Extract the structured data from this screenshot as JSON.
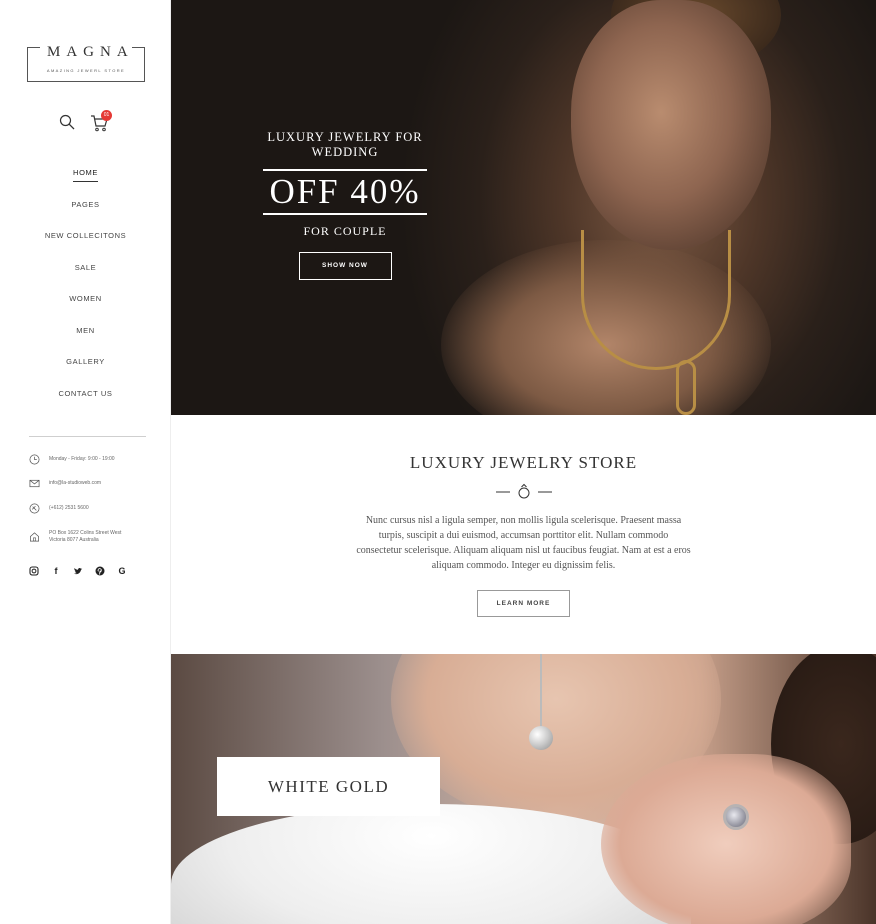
{
  "brand": {
    "name": "MAGNA",
    "tagline": "AMAZING JEWERL STORE"
  },
  "cart": {
    "count": "01"
  },
  "nav": {
    "items": [
      {
        "label": "HOME",
        "active": true
      },
      {
        "label": "PAGES"
      },
      {
        "label": "NEW COLLECITONS"
      },
      {
        "label": "SALE"
      },
      {
        "label": "WOMEN"
      },
      {
        "label": "MEN"
      },
      {
        "label": "GALLERY"
      },
      {
        "label": "CONTACT US"
      }
    ]
  },
  "contact": {
    "hours": "Monday - Friday: 9:00 - 19:00",
    "email": "info@la-studioweb.com",
    "phone": "(+612) 2531 5600",
    "address_line1": "PO Box 1622 Colins Street West",
    "address_line2": "Victoria 8077 Australia"
  },
  "socials": [
    "instagram-icon",
    "facebook-icon",
    "twitter-icon",
    "pinterest-icon",
    "google-icon"
  ],
  "hero": {
    "line1": "LUXURY JEWELRY FOR",
    "line2": "WEDDING",
    "offer": "OFF 40%",
    "subline": "FOR COUPLE",
    "button": "SHOW NOW"
  },
  "about": {
    "title": "LUXURY JEWELRY STORE",
    "text": "Nunc cursus nisl a ligula semper, non mollis ligula scelerisque. Praesent massa turpis, suscipit a dui euismod, accumsan porttitor elit. Nullam commodo consectetur scelerisque. Aliquam aliquam nisl ut faucibus feugiat. Nam at est a eros aliquam commodo. Integer eu dignissim felis.",
    "button": "LEARN MORE"
  },
  "banner": {
    "label": "WHITE GOLD"
  },
  "colors": {
    "badge": "#e53935",
    "text": "#333333",
    "hero_bg": "#2a201a"
  }
}
